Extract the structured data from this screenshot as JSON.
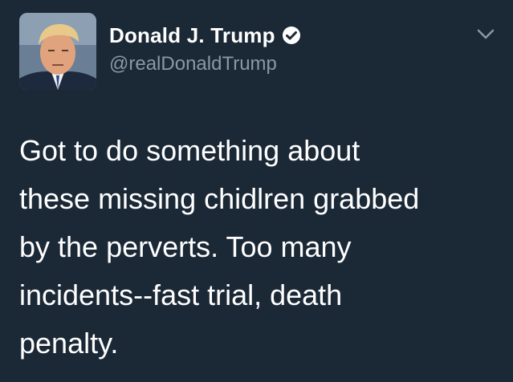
{
  "tweet": {
    "author": {
      "display_name": "Donald J. Trump",
      "handle": "@realDonaldTrump",
      "verified": true,
      "avatar": "profile-photo"
    },
    "text_lines": [
      "Got to do something about",
      "these missing chidlren grabbed",
      "by the perverts. Too many",
      "incidents--fast trial, death",
      "penalty."
    ],
    "menu_icon": "chevron-down-icon",
    "colors": {
      "background": "#1b2836",
      "text": "#ffffff",
      "handle": "#8899a6",
      "caret": "#8899a6"
    }
  }
}
